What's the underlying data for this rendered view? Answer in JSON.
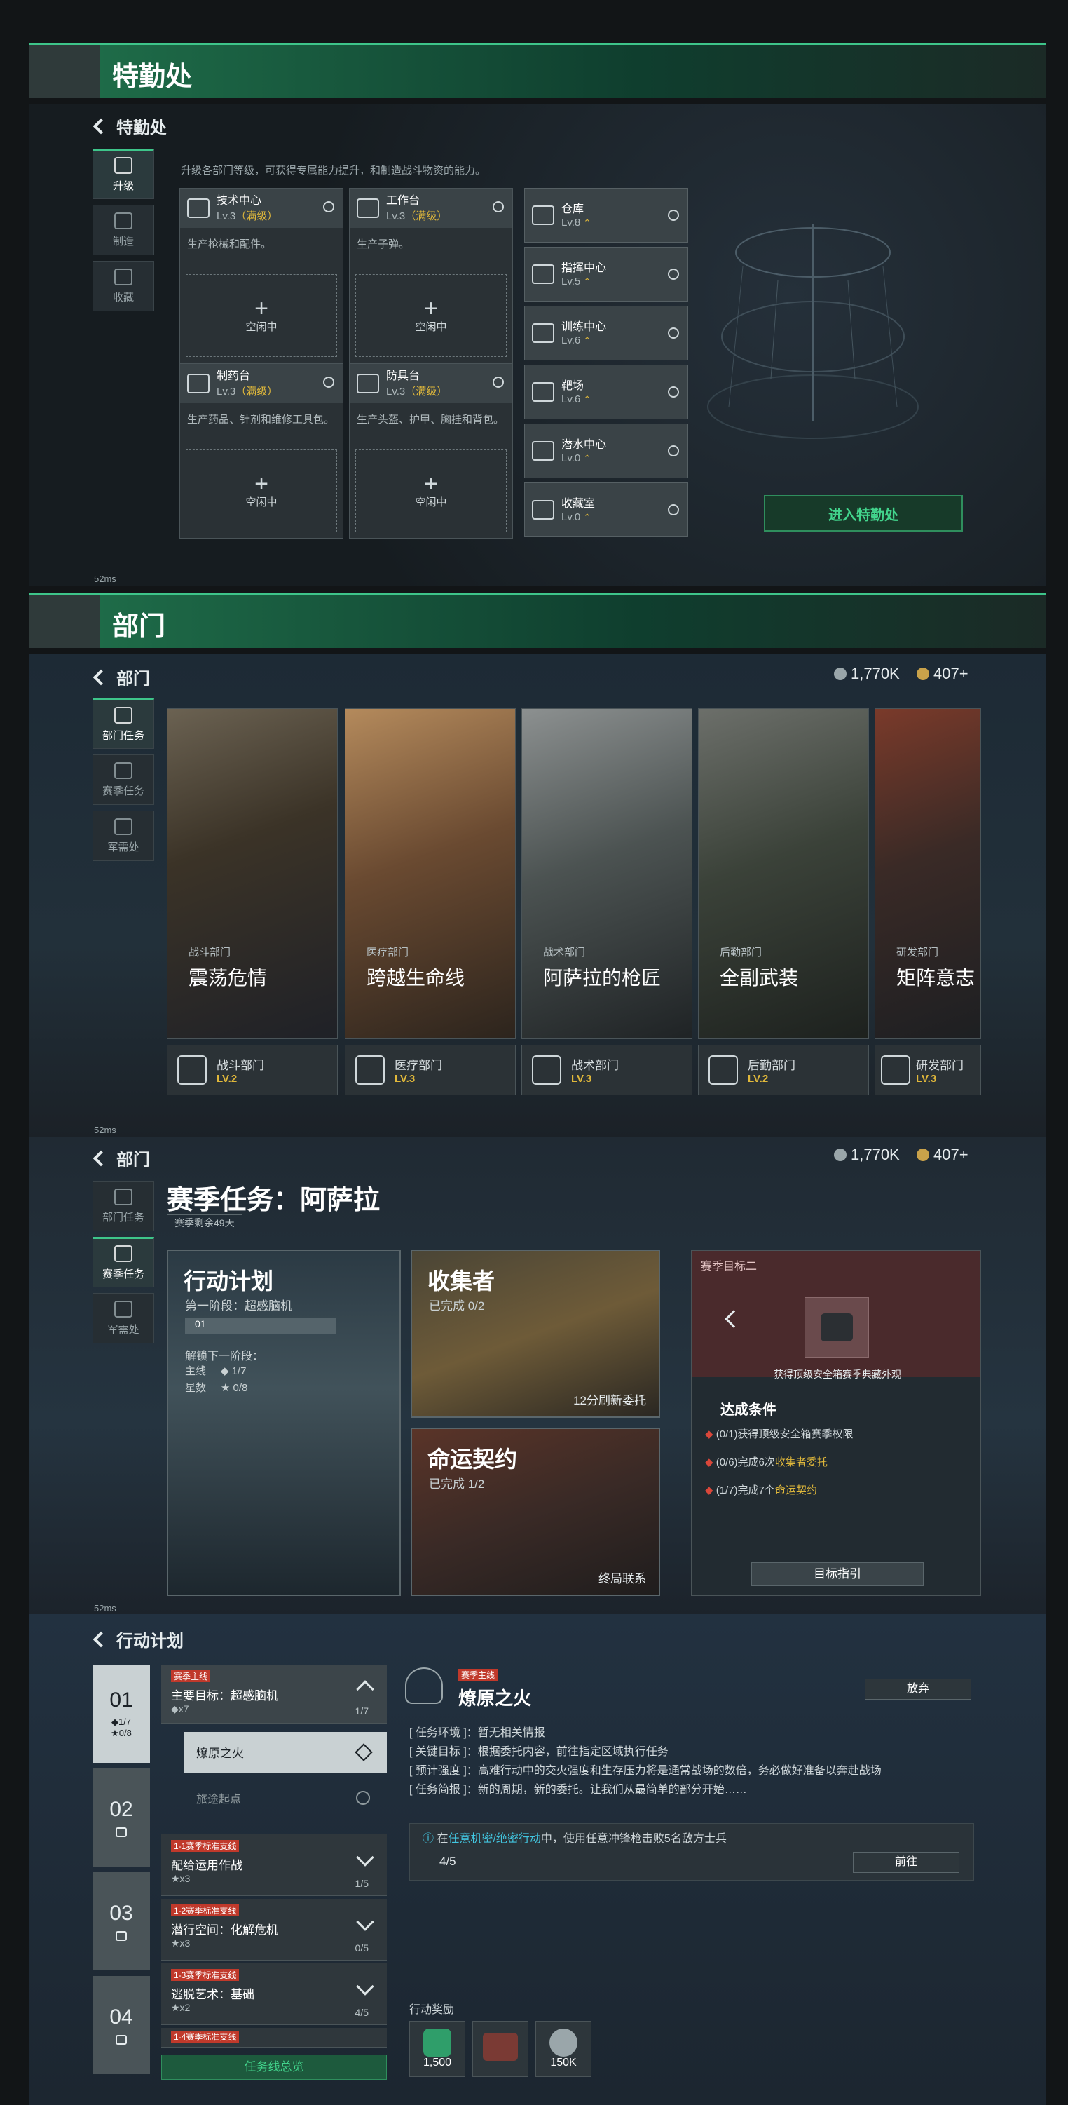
{
  "section1": {
    "title": "特勤处",
    "back_label": "特勤处",
    "nav": [
      "升级",
      "制造",
      "收藏"
    ],
    "intro": "升级各部门等级，可获得专属能力提升，和制造战斗物资的能力。",
    "cards": [
      {
        "name": "技术中心",
        "level": "Lv.3",
        "max": "（满级）",
        "desc": "生产枪械和配件。",
        "slot": "空闲中"
      },
      {
        "name": "工作台",
        "level": "Lv.3",
        "max": "（满级）",
        "desc": "生产子弹。",
        "slot": "空闲中"
      },
      {
        "name": "制药台",
        "level": "Lv.3",
        "max": "（满级）",
        "desc": "生产药品、针剂和维修工具包。",
        "slot": "空闲中"
      },
      {
        "name": "防具台",
        "level": "Lv.3",
        "max": "（满级）",
        "desc": "生产头盔、护甲、胸挂和背包。",
        "slot": "空闲中"
      }
    ],
    "side_cards": [
      {
        "name": "仓库",
        "level": "Lv.8"
      },
      {
        "name": "指挥中心",
        "level": "Lv.5"
      },
      {
        "name": "训练中心",
        "level": "Lv.6"
      },
      {
        "name": "靶场",
        "level": "Lv.6"
      },
      {
        "name": "潜水中心",
        "level": "Lv.0"
      },
      {
        "name": "收藏室",
        "level": "Lv.0"
      }
    ],
    "enter_button": "进入特勤处",
    "ping": "52ms"
  },
  "section2": {
    "title": "部门",
    "back_label": "部门",
    "nav": [
      "部门任务",
      "赛季任务",
      "军需处"
    ],
    "currency_a": "1,770K",
    "currency_b": "407+",
    "departments": [
      {
        "sub": "战斗部门",
        "name": "震荡危情",
        "dept": "战斗部门",
        "level": "LV.2"
      },
      {
        "sub": "医疗部门",
        "name": "跨越生命线",
        "dept": "医疗部门",
        "level": "LV.3"
      },
      {
        "sub": "战术部门",
        "name": "阿萨拉的枪匠",
        "dept": "战术部门",
        "level": "LV.3"
      },
      {
        "sub": "后勤部门",
        "name": "全副武装",
        "dept": "后勤部门",
        "level": "LV.2"
      },
      {
        "sub": "研发部门",
        "name": "矩阵意志",
        "dept": "研发部门",
        "level": "LV.3"
      }
    ],
    "ping": "52ms"
  },
  "section3": {
    "back_label": "部门",
    "nav": [
      "部门任务",
      "赛季任务",
      "军需处"
    ],
    "currency_a": "1,770K",
    "currency_b": "407+",
    "title": "赛季任务：阿萨拉",
    "remaining": "赛季剩余49天",
    "plan": {
      "title": "行动计划",
      "stage": "第一阶段：超感脑机",
      "stage_num": "01",
      "unlock": "解锁下一阶段：",
      "main_label": "主线",
      "main_val": "◆ 1/7",
      "star_label": "星数",
      "star_val": "★ 0/8"
    },
    "collector": {
      "title": "收集者",
      "done": "已完成 0/2",
      "refresh": "12分刷新委托"
    },
    "fate": {
      "title": "命运契约",
      "done": "已完成 1/2",
      "footer": "终局联系"
    },
    "goal": {
      "header": "赛季目标二",
      "reward_desc": "获得顶级安全箱赛季典藏外观",
      "cond_title": "达成条件",
      "conds": [
        {
          "prefix": "(0/1)获得顶级安全箱赛季权限",
          "hl": ""
        },
        {
          "prefix": "(0/6)完成6次",
          "hl": "收集者委托"
        },
        {
          "prefix": "(1/7)完成7个",
          "hl": "命运契约"
        }
      ],
      "button": "目标指引"
    },
    "ping": "52ms"
  },
  "section4": {
    "back_label": "行动计划",
    "tabs": [
      {
        "num": "01",
        "main": "◆1/7",
        "star": "★0/8"
      },
      {
        "num": "02"
      },
      {
        "num": "03"
      },
      {
        "num": "04"
      }
    ],
    "main_task": {
      "tag": "赛季主线",
      "name": "主要目标：超感脑机",
      "stars": "◆x7",
      "count": "1/7"
    },
    "subs": [
      {
        "name": "燎原之火"
      },
      {
        "name": "旅途起点"
      }
    ],
    "side_tasks": [
      {
        "tag": "1-1赛季标准支线",
        "name": "配给运用作战",
        "stars": "★x3",
        "count": "1/5"
      },
      {
        "tag": "1-2赛季标准支线",
        "name": "潜行空间：化解危机",
        "stars": "★x3",
        "count": "0/5"
      },
      {
        "tag": "1-3赛季标准支线",
        "name": "逃脱艺术：基础",
        "stars": "★x2",
        "count": "4/5"
      },
      {
        "tag": "1-4赛季标准支线",
        "name": "",
        "stars": "",
        "count": ""
      }
    ],
    "overview_button": "任务线总览",
    "detail": {
      "tag": "赛季主线",
      "title": "燎原之火",
      "abandon": "放弃",
      "env": "[ 任务环境 ]：暂无相关情报",
      "key": "[ 关键目标 ]：根据委托内容，前往指定区域执行任务",
      "intensity": "[ 预计强度 ]：高难行动中的交火强度和生存压力将是通常战场的数倍，务必做好准备以奔赴战场",
      "brief": "[ 任务简报 ]：新的周期，新的委托。让我们从最简单的部分开始……",
      "obj_pre": "在",
      "obj_hl": "任意机密/绝密行动",
      "obj_post": "中，使用任意冲锋枪击败5名敌方士兵",
      "obj_progress": "4/5",
      "goto": "前往",
      "reward_title": "行动奖励",
      "rewards": [
        "1,500",
        "",
        "150K"
      ]
    }
  },
  "colors": {
    "accent": "#3ec58a",
    "gold": "#e0b83b",
    "red": "#c0392b"
  }
}
